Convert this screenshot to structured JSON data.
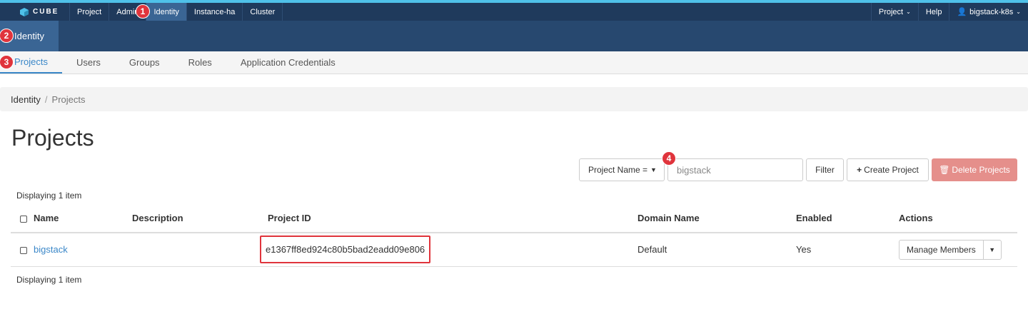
{
  "topnav": {
    "brand": "CUBE",
    "items": [
      "Project",
      "Admin",
      "Identity",
      "Instance-ha",
      "Cluster"
    ],
    "right": {
      "project": "Project",
      "help": "Help",
      "user": "bigstack-k8s"
    }
  },
  "subnav": {
    "identity": "Identity"
  },
  "tabs": [
    "Projects",
    "Users",
    "Groups",
    "Roles",
    "Application Credentials"
  ],
  "breadcrumb": {
    "root": "Identity",
    "sep": "/",
    "current": "Projects"
  },
  "page_title": "Projects",
  "filter": {
    "select": "Project Name =",
    "input_value": "bigstack",
    "filter_btn": "Filter",
    "create_btn": "Create Project",
    "delete_btn": "Delete Projects"
  },
  "display_count": "Displaying 1 item",
  "table": {
    "headers": [
      "Name",
      "Description",
      "Project ID",
      "Domain Name",
      "Enabled",
      "Actions"
    ],
    "row": {
      "name": "bigstack",
      "description": "",
      "project_id": "e1367ff8ed924c80b5bad2eadd09e806",
      "domain": "Default",
      "enabled": "Yes",
      "action": "Manage Members"
    }
  },
  "markers": [
    "1",
    "2",
    "3",
    "4"
  ],
  "colors": {
    "accent": "#4fc1e9",
    "nav_bg": "#1f3a5c",
    "highlight": "#e0343c",
    "link": "#3a87c8",
    "danger": "#e58f8b"
  }
}
